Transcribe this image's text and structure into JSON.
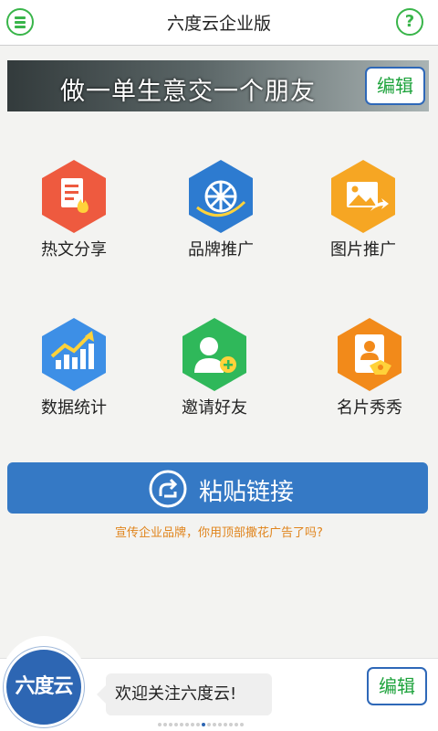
{
  "header": {
    "title": "六度云企业版",
    "menu_icon": "menu-icon",
    "help_icon": "help-icon",
    "help_glyph": "?"
  },
  "banner": {
    "slogan": "做一单生意交一个朋友",
    "edit_label": "编辑"
  },
  "grid": {
    "items": [
      {
        "label": "热文分享",
        "icon": "hot-article-icon",
        "color": "#ee5a3f"
      },
      {
        "label": "品牌推广",
        "icon": "brand-promotion-icon",
        "color": "#2d7bd0"
      },
      {
        "label": "图片推广",
        "icon": "image-promotion-icon",
        "color": "#f6a623"
      },
      {
        "label": "数据统计",
        "icon": "statistics-icon",
        "color": "#3d8fe6"
      },
      {
        "label": "邀请好友",
        "icon": "invite-friend-icon",
        "color": "#2fb85a"
      },
      {
        "label": "名片秀秀",
        "icon": "business-card-icon",
        "color": "#f28a1a"
      }
    ]
  },
  "paste": {
    "label": "粘贴链接",
    "hint": "宣传企业品牌，你用顶部撒花广告了吗?"
  },
  "footer": {
    "logo_text": "六度云",
    "welcome": "欢迎关注六度云!",
    "edit_label": "编辑"
  },
  "pager": {
    "count": 16,
    "active_index": 8
  },
  "colors": {
    "accent_green": "#39b54a",
    "primary_blue": "#3579c5",
    "hint_orange": "#e0841c"
  }
}
